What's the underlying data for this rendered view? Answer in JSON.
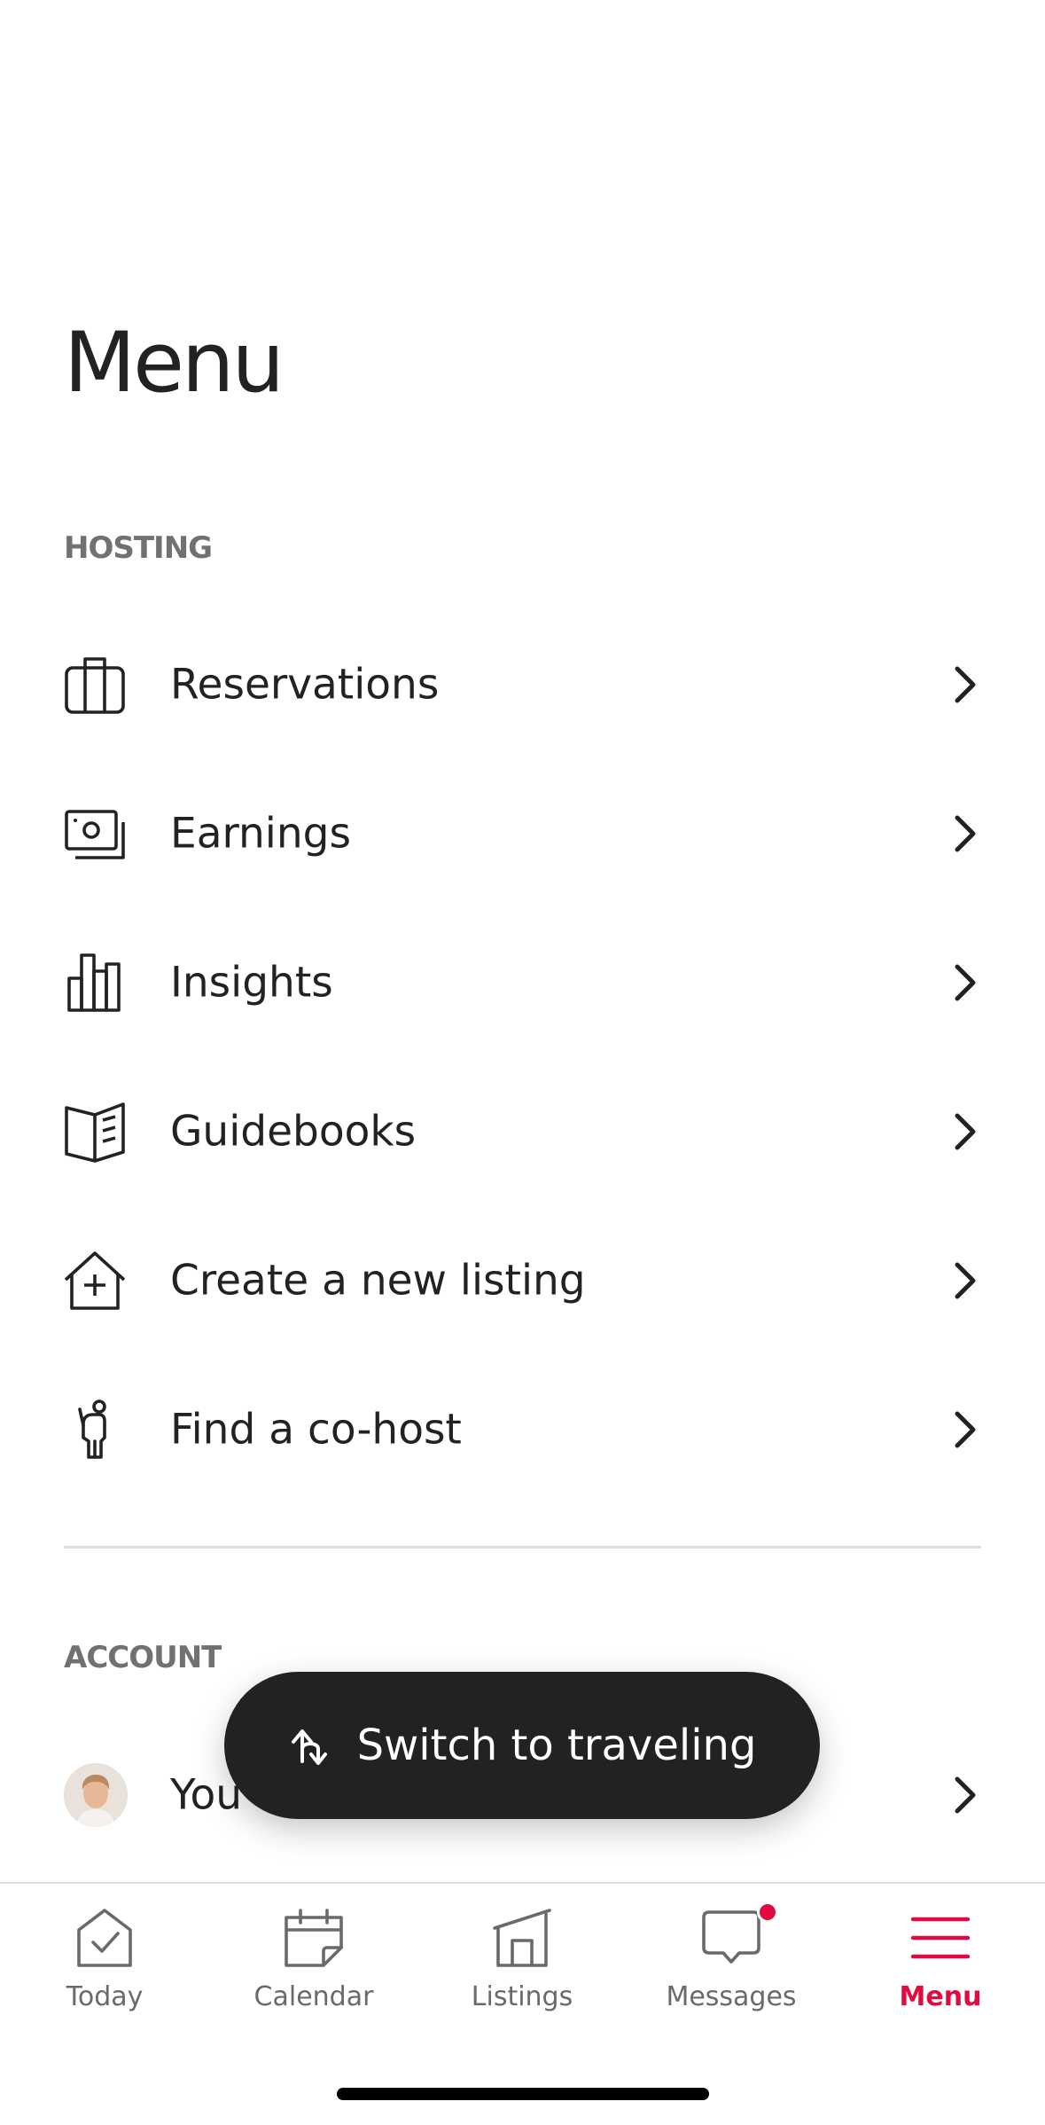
{
  "title": "Menu",
  "hosting": {
    "header": "HOSTING",
    "items": [
      {
        "label": "Reservations",
        "icon": "suitcase-icon"
      },
      {
        "label": "Earnings",
        "icon": "money-icon"
      },
      {
        "label": "Insights",
        "icon": "bar-chart-icon"
      },
      {
        "label": "Guidebooks",
        "icon": "book-icon"
      },
      {
        "label": "Create a new listing",
        "icon": "house-plus-icon"
      },
      {
        "label": "Find a co-host",
        "icon": "person-icon"
      }
    ]
  },
  "account": {
    "header": "ACCOUNT",
    "items": [
      {
        "label": "You",
        "icon": "avatar"
      }
    ]
  },
  "switch_button": {
    "label": "Switch to traveling",
    "icon": "switch-arrows-icon"
  },
  "tabbar": {
    "tabs": [
      {
        "label": "Today",
        "icon": "today-check-icon",
        "active": false
      },
      {
        "label": "Calendar",
        "icon": "calendar-icon",
        "active": false
      },
      {
        "label": "Listings",
        "icon": "listings-house-icon",
        "active": false
      },
      {
        "label": "Messages",
        "icon": "message-bubble-icon",
        "active": false,
        "badge": true
      },
      {
        "label": "Menu",
        "icon": "hamburger-menu-icon",
        "active": true
      }
    ]
  },
  "colors": {
    "accent": "#e00b41",
    "text": "#222222",
    "muted": "#717171",
    "button_bg": "#222222"
  }
}
